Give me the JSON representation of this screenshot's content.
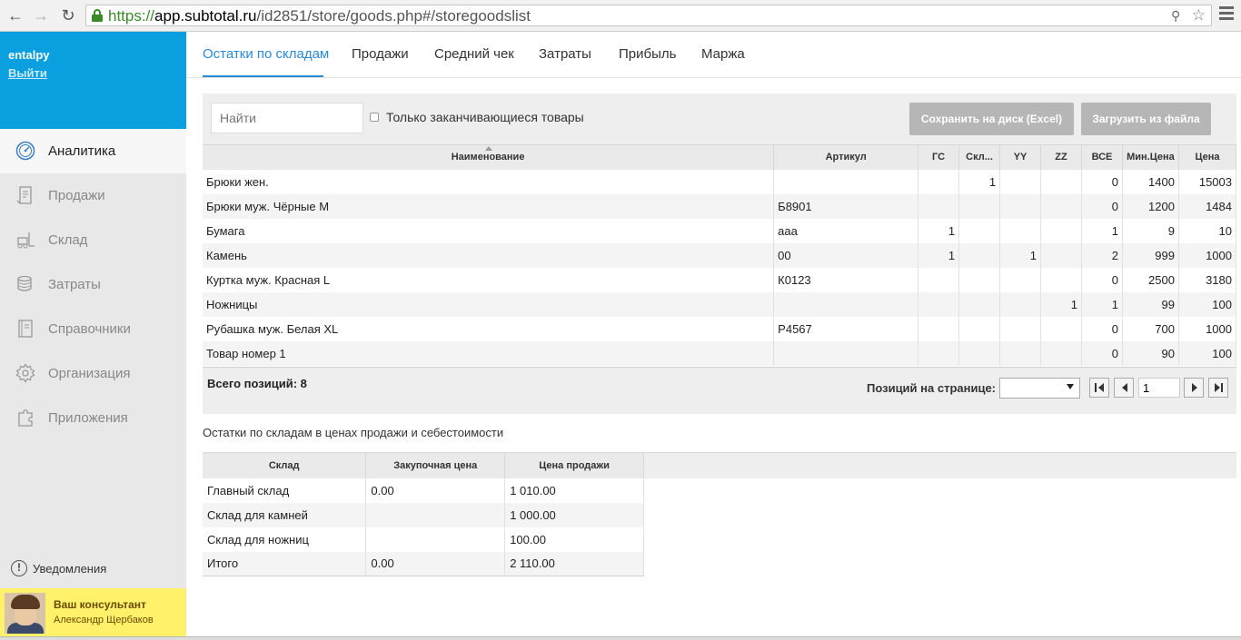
{
  "browser": {
    "url_scheme": "https://",
    "url_host": "app.subtotal.ru",
    "url_path": "/id2851/store/goods.php#/storegoodslist"
  },
  "sidebar": {
    "user_name": "entalpy",
    "logout_label": "Выйти",
    "items": [
      {
        "label": "Аналитика",
        "icon": "dashboard-icon",
        "active": true
      },
      {
        "label": "Продажи",
        "icon": "receipt-icon",
        "active": false
      },
      {
        "label": "Склад",
        "icon": "forklift-icon",
        "active": false
      },
      {
        "label": "Затраты",
        "icon": "coins-icon",
        "active": false
      },
      {
        "label": "Справочники",
        "icon": "book-icon",
        "active": false
      },
      {
        "label": "Организация",
        "icon": "gear-icon",
        "active": false
      },
      {
        "label": "Приложения",
        "icon": "puzzle-icon",
        "active": false
      }
    ],
    "notifications_label": "Уведомления",
    "consultant": {
      "title": "Ваш консультант",
      "name": "Александр Щербаков"
    }
  },
  "tabs": [
    {
      "label": "Остатки по складам",
      "active": true
    },
    {
      "label": "Продажи",
      "active": false
    },
    {
      "label": "Средний чек",
      "active": false
    },
    {
      "label": "Затраты",
      "active": false
    },
    {
      "label": "Прибыль",
      "active": false
    },
    {
      "label": "Маржа",
      "active": false
    }
  ],
  "toolbar": {
    "search_placeholder": "Найти",
    "ending_goods_label": "Только заканчивающиеся товары",
    "save_label": "Сохранить на диск (Excel)",
    "load_label": "Загрузить из файла"
  },
  "goods_table": {
    "columns": [
      "Наименование",
      "Артикул",
      "ГС",
      "Скл...",
      "YY",
      "ZZ",
      "ВСЕ",
      "Мин.Цена",
      "Цена"
    ],
    "rows": [
      [
        "Брюки жен.",
        "",
        "",
        "1",
        "",
        "",
        "0",
        "1400",
        "15003"
      ],
      [
        "Брюки муж. Чёрные M",
        "Б8901",
        "",
        "",
        "",
        "",
        "0",
        "1200",
        "1484"
      ],
      [
        "Бумага",
        "ааа",
        "1",
        "",
        "",
        "",
        "1",
        "9",
        "10"
      ],
      [
        "Камень",
        "00",
        "1",
        "",
        "1",
        "",
        "2",
        "999",
        "1000"
      ],
      [
        "Куртка муж. Красная L",
        "К0123",
        "",
        "",
        "",
        "",
        "0",
        "2500",
        "3180"
      ],
      [
        "Ножницы",
        "",
        "",
        "",
        "",
        "1",
        "1",
        "99",
        "100"
      ],
      [
        "Рубашка муж. Белая XL",
        "Р4567",
        "",
        "",
        "",
        "",
        "0",
        "700",
        "1000"
      ],
      [
        "Товар номер 1",
        "",
        "",
        "",
        "",
        "",
        "0",
        "90",
        "100"
      ]
    ]
  },
  "pager": {
    "total_label": "Всего позиций: 8",
    "per_page_label": "Позиций на странице:",
    "page": "1"
  },
  "summary": {
    "title": "Остатки по складам в ценах продажи и себестоимости",
    "columns": [
      "Склад",
      "Закупочная цена",
      "Цена продажи"
    ],
    "rows": [
      [
        "Главный склад",
        "0.00",
        "1 010.00"
      ],
      [
        "Склад для камней",
        "",
        "1 000.00"
      ],
      [
        "Склад для ножниц",
        "",
        "100.00"
      ],
      [
        "Итого",
        "0.00",
        "2 110.00"
      ]
    ]
  }
}
